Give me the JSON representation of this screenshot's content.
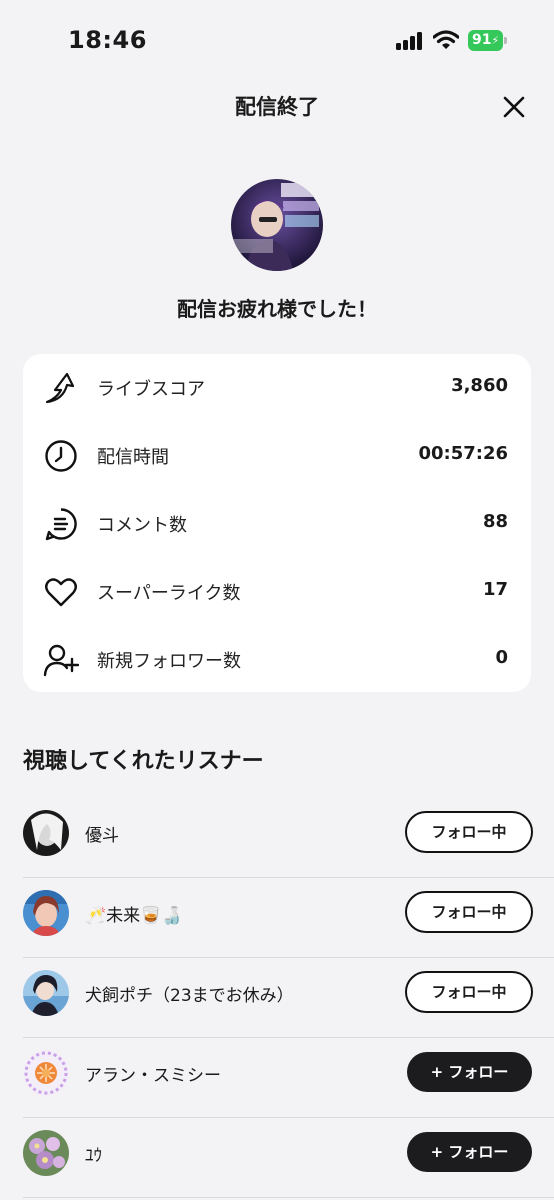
{
  "status_bar": {
    "time": "18:46",
    "battery": "91"
  },
  "header": {
    "title": "配信終了",
    "close_icon": "close-icon"
  },
  "greeting": "配信お疲れ様でした！",
  "stats": [
    {
      "icon": "live-score-arrow-icon",
      "label": "ライブスコア",
      "value": "3,860"
    },
    {
      "icon": "clock-icon",
      "label": "配信時間",
      "value": "00:57:26"
    },
    {
      "icon": "comment-icon",
      "label": "コメント数",
      "value": "88"
    },
    {
      "icon": "heart-icon",
      "label": "スーパーライク数",
      "value": "17"
    },
    {
      "icon": "add-user-icon",
      "label": "新規フォロワー数",
      "value": "0"
    }
  ],
  "listeners_section": {
    "title": "視聴してくれたリスナー"
  },
  "listeners": [
    {
      "name": "優斗",
      "button": "フォロー中",
      "following": true
    },
    {
      "name": "🥂未来🥃🍶",
      "button": "フォロー中",
      "following": true
    },
    {
      "name": "犬飼ポチ（23までお休み）",
      "button": "フォロー中",
      "following": true
    },
    {
      "name": "アラン・スミシー",
      "button": "+ フォロー",
      "following": false
    },
    {
      "name": "ﾕｳ",
      "button": "+ フォロー",
      "following": false
    }
  ],
  "colors": {
    "background": "#f3f2f4",
    "card": "#ffffff",
    "battery": "#34c759",
    "follow_button": "#1c1c1e"
  }
}
